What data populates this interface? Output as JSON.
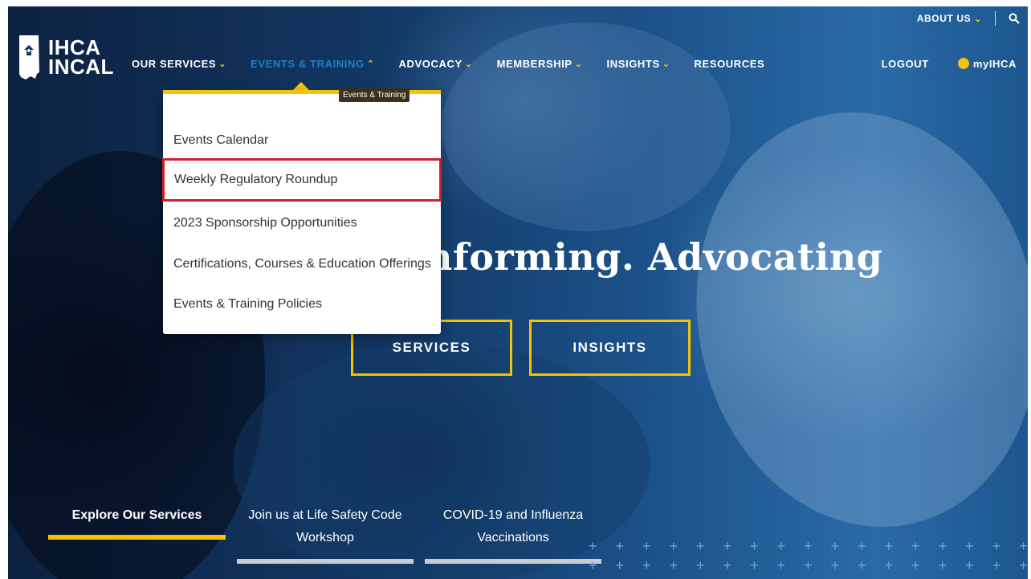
{
  "logo": {
    "line1": "IHCA",
    "line2": "INCAL",
    "icon": "indiana-state-icon"
  },
  "top_utility": {
    "about_label": "ABOUT US",
    "search_icon": "search-icon"
  },
  "nav": {
    "items": [
      {
        "label": "OUR SERVICES"
      },
      {
        "label": "EVENTS & TRAINING"
      },
      {
        "label": "ADVOCACY"
      },
      {
        "label": "MEMBERSHIP"
      },
      {
        "label": "INSIGHTS"
      },
      {
        "label": "RESOURCES"
      }
    ],
    "logout_label": "LOGOUT",
    "account_label": "myIHCA",
    "account_icon": "user-icon"
  },
  "dropdown": {
    "tooltip": "Events & Training",
    "items": [
      {
        "label": "Events Calendar"
      },
      {
        "label": "Weekly Regulatory Roundup"
      },
      {
        "label": "2023 Sponsorship Opportunities"
      },
      {
        "label": "Certifications, Courses & Education Offerings"
      },
      {
        "label": "Events & Training Policies"
      }
    ]
  },
  "hero": {
    "title": "nforming. Advocating",
    "buttons": [
      {
        "label": "SERVICES"
      },
      {
        "label": "INSIGHTS"
      }
    ]
  },
  "slider_tabs": [
    {
      "label": "Explore Our Services"
    },
    {
      "label": "Join us at Life Safety Code Workshop"
    },
    {
      "label": "COVID-19 and Influenza Vaccinations"
    }
  ],
  "colors": {
    "accent": "#f5c400",
    "active_nav": "#1e7fc8",
    "highlight_box": "#d11f2a"
  }
}
